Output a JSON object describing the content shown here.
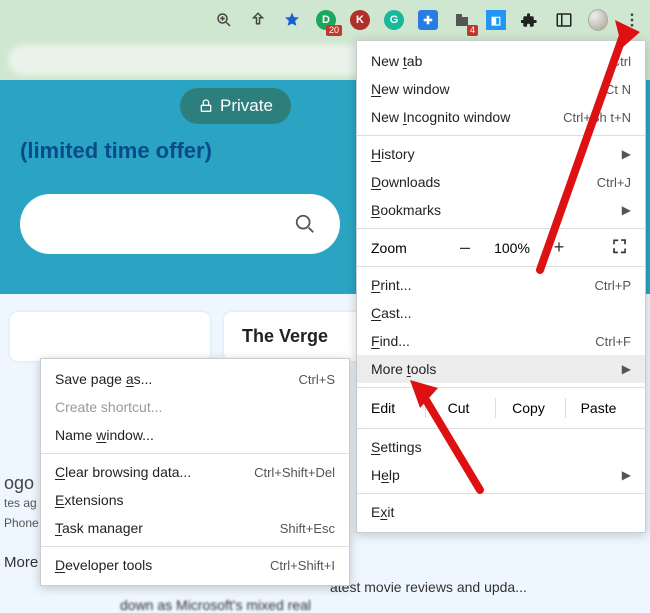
{
  "toolbar": {
    "badge20": "20",
    "badge4": "4"
  },
  "page": {
    "private": "Private",
    "offer": "(limited time offer)",
    "card_title": "The Verge",
    "stump_ogo": "ogo",
    "stump_ago": "tes ag",
    "stump_phone": "Phone",
    "stump_more": "More",
    "bottom1": "atest movie reviews and upda...",
    "bottom2": "down as Microsoft's mixed real"
  },
  "menu": {
    "new_tab": "New tab",
    "new_tab_u": "t",
    "new_tab_sc": "Ctrl",
    "new_window": "New window",
    "new_window_u": "N",
    "new_window_sc": "Ct   N",
    "incognito": "New Incognito window",
    "incognito_u": "I",
    "incognito_sc": "Ctrl+Sh   t+N",
    "history": "History",
    "history_u": "H",
    "downloads": "Downloads",
    "downloads_u": "D",
    "downloads_sc": "Ctrl+J",
    "bookmarks": "Bookmarks",
    "bookmarks_u": "B",
    "zoom": "Zoom",
    "zoom_pct": "100%",
    "zoom_minus": "–",
    "zoom_plus": "+",
    "print": "Print...",
    "print_u": "P",
    "print_sc": "Ctrl+P",
    "cast": "Cast...",
    "cast_u": "C",
    "find": "Find...",
    "find_u": "F",
    "find_sc": "Ctrl+F",
    "more_tools": "More tools",
    "more_tools_u": "t",
    "edit": "Edit",
    "cut": "Cut",
    "copy": "Copy",
    "paste": "Paste",
    "settings": "Settings",
    "settings_u": "S",
    "help": "Help",
    "help_u": "e",
    "exit": "Exit",
    "exit_u": "x"
  },
  "submenu": {
    "save_as": "Save page as...",
    "save_as_u": "a",
    "save_as_sc": "Ctrl+S",
    "shortcut": "Create shortcut...",
    "name_window": "Name window...",
    "name_window_u": "w",
    "clear": "Clear browsing data...",
    "clear_u": "C",
    "clear_sc": "Ctrl+Shift+Del",
    "extensions": "Extensions",
    "extensions_u": "E",
    "task": "Task manager",
    "task_u": "T",
    "task_sc": "Shift+Esc",
    "dev": "Developer tools",
    "dev_u": "D",
    "dev_sc": "Ctrl+Shift+I"
  }
}
